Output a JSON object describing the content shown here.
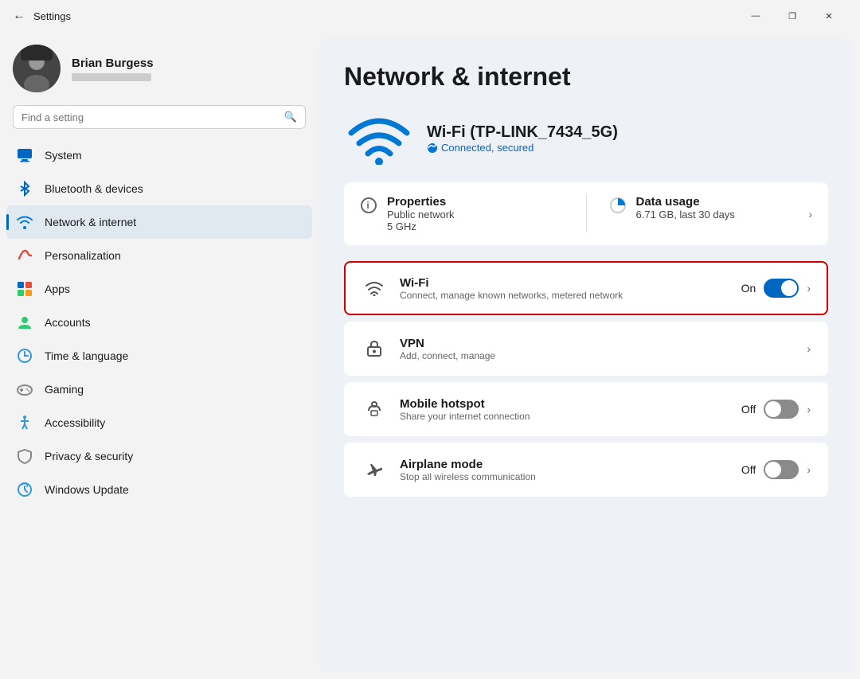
{
  "titlebar": {
    "title": "Settings",
    "minimize": "—",
    "maximize": "❐",
    "close": "✕"
  },
  "sidebar": {
    "back_icon": "←",
    "search": {
      "placeholder": "Find a setting",
      "icon": "🔍"
    },
    "user": {
      "name": "Brian Burgess"
    },
    "nav_items": [
      {
        "id": "system",
        "label": "System",
        "icon": "system"
      },
      {
        "id": "bluetooth",
        "label": "Bluetooth & devices",
        "icon": "bluetooth"
      },
      {
        "id": "network",
        "label": "Network & internet",
        "icon": "network",
        "active": true
      },
      {
        "id": "personalization",
        "label": "Personalization",
        "icon": "personalization"
      },
      {
        "id": "apps",
        "label": "Apps",
        "icon": "apps"
      },
      {
        "id": "accounts",
        "label": "Accounts",
        "icon": "accounts"
      },
      {
        "id": "time",
        "label": "Time & language",
        "icon": "time"
      },
      {
        "id": "gaming",
        "label": "Gaming",
        "icon": "gaming"
      },
      {
        "id": "accessibility",
        "label": "Accessibility",
        "icon": "accessibility"
      },
      {
        "id": "privacy",
        "label": "Privacy & security",
        "icon": "privacy"
      },
      {
        "id": "update",
        "label": "Windows Update",
        "icon": "update"
      }
    ]
  },
  "content": {
    "page_title": "Network & internet",
    "wifi_name": "Wi-Fi (TP-LINK_7434_5G)",
    "wifi_status": "Connected, secured",
    "properties": {
      "label": "Properties",
      "line1": "Public network",
      "line2": "5 GHz"
    },
    "data_usage": {
      "label": "Data usage",
      "value": "6.71 GB, last 30 days"
    },
    "rows": [
      {
        "id": "wifi",
        "title": "Wi-Fi",
        "subtitle": "Connect, manage known networks, metered network",
        "toggle": "on",
        "toggle_label": "On",
        "highlighted": true
      },
      {
        "id": "vpn",
        "title": "VPN",
        "subtitle": "Add, connect, manage",
        "toggle": null,
        "highlighted": false
      },
      {
        "id": "hotspot",
        "title": "Mobile hotspot",
        "subtitle": "Share your internet connection",
        "toggle": "off",
        "toggle_label": "Off",
        "highlighted": false
      },
      {
        "id": "airplane",
        "title": "Airplane mode",
        "subtitle": "Stop all wireless communication",
        "toggle": "off",
        "toggle_label": "Off",
        "highlighted": false
      }
    ]
  }
}
